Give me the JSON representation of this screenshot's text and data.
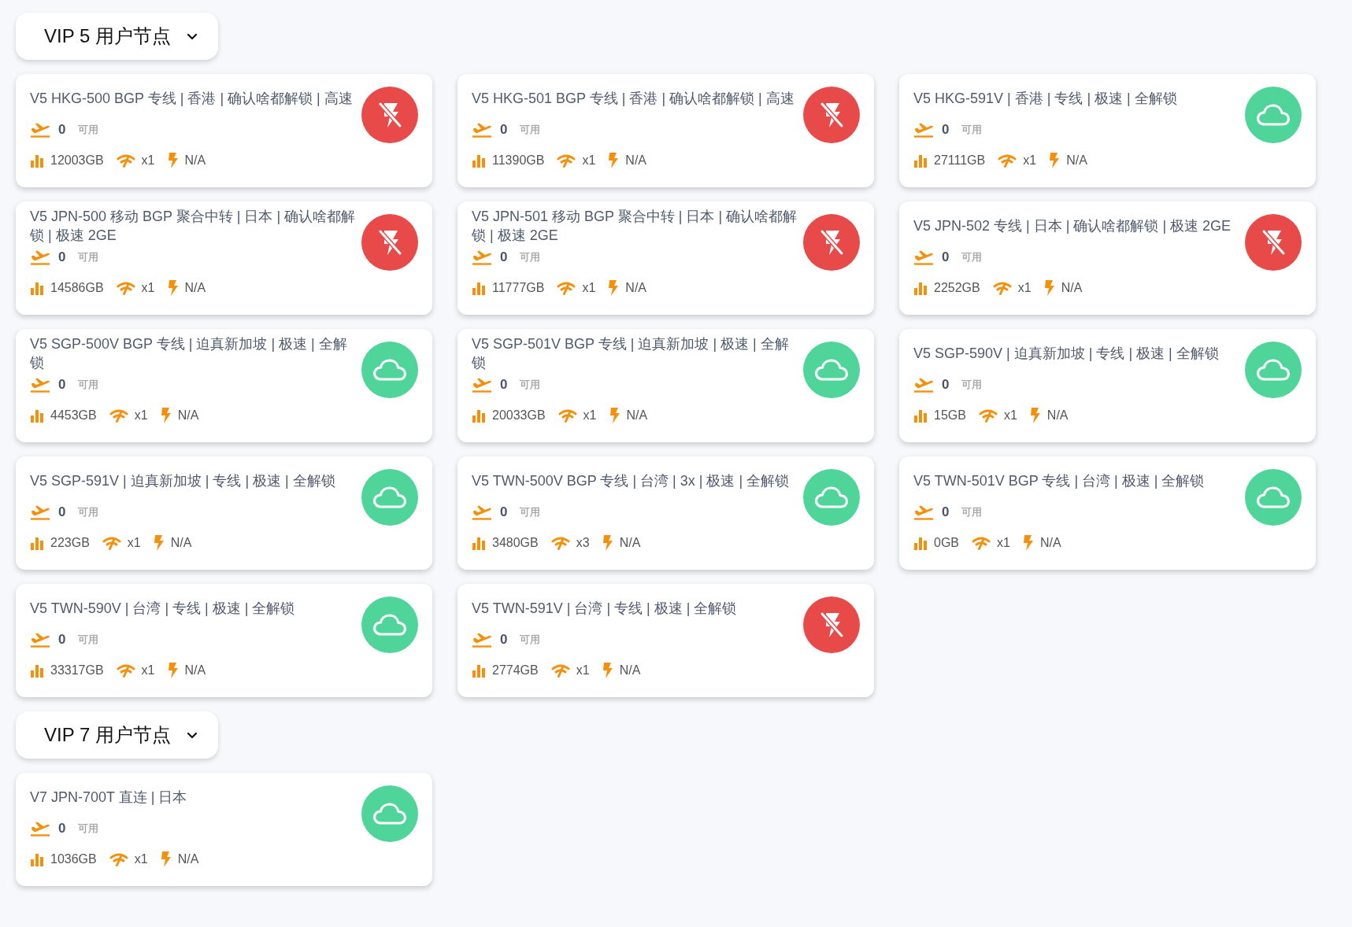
{
  "sections": [
    {
      "title": "VIP 5 用户节点",
      "nodes": [
        {
          "name": "V5 HKG-500 BGP 专线 | 香港 | 确认啥都解锁 | 高速",
          "online": false,
          "available": "0",
          "available_label": "可用",
          "traffic": "12003GB",
          "multiplier": "x1",
          "rate": "N/A"
        },
        {
          "name": "V5 HKG-501 BGP 专线 | 香港 | 确认啥都解锁 | 高速",
          "online": false,
          "available": "0",
          "available_label": "可用",
          "traffic": "11390GB",
          "multiplier": "x1",
          "rate": "N/A"
        },
        {
          "name": "V5 HKG-591V | 香港 | 专线 | 极速 | 全解锁",
          "online": true,
          "available": "0",
          "available_label": "可用",
          "traffic": "27111GB",
          "multiplier": "x1",
          "rate": "N/A"
        },
        {
          "name": "V5 JPN-500 移动 BGP 聚合中转 | 日本 | 确认啥都解锁 | 极速 2GE",
          "online": false,
          "available": "0",
          "available_label": "可用",
          "traffic": "14586GB",
          "multiplier": "x1",
          "rate": "N/A"
        },
        {
          "name": "V5 JPN-501 移动 BGP 聚合中转 | 日本 | 确认啥都解锁 | 极速 2GE",
          "online": false,
          "available": "0",
          "available_label": "可用",
          "traffic": "11777GB",
          "multiplier": "x1",
          "rate": "N/A"
        },
        {
          "name": "V5 JPN-502 专线 | 日本 | 确认啥都解锁 | 极速 2GE",
          "online": false,
          "available": "0",
          "available_label": "可用",
          "traffic": "2252GB",
          "multiplier": "x1",
          "rate": "N/A"
        },
        {
          "name": "V5 SGP-500V BGP 专线 | 迫真新加坡 | 极速 | 全解锁",
          "online": true,
          "available": "0",
          "available_label": "可用",
          "traffic": "4453GB",
          "multiplier": "x1",
          "rate": "N/A"
        },
        {
          "name": "V5 SGP-501V BGP 专线 | 迫真新加坡 | 极速 | 全解锁",
          "online": true,
          "available": "0",
          "available_label": "可用",
          "traffic": "20033GB",
          "multiplier": "x1",
          "rate": "N/A"
        },
        {
          "name": "V5 SGP-590V | 迫真新加坡 | 专线 | 极速 | 全解锁",
          "online": true,
          "available": "0",
          "available_label": "可用",
          "traffic": "15GB",
          "multiplier": "x1",
          "rate": "N/A"
        },
        {
          "name": "V5 SGP-591V | 迫真新加坡 | 专线 | 极速 | 全解锁",
          "online": true,
          "available": "0",
          "available_label": "可用",
          "traffic": "223GB",
          "multiplier": "x1",
          "rate": "N/A"
        },
        {
          "name": "V5 TWN-500V BGP 专线 | 台湾 | 3x | 极速 | 全解锁",
          "online": true,
          "available": "0",
          "available_label": "可用",
          "traffic": "3480GB",
          "multiplier": "x3",
          "rate": "N/A"
        },
        {
          "name": "V5 TWN-501V BGP 专线 | 台湾 | 极速 | 全解锁",
          "online": true,
          "available": "0",
          "available_label": "可用",
          "traffic": "0GB",
          "multiplier": "x1",
          "rate": "N/A"
        },
        {
          "name": "V5 TWN-590V | 台湾 | 专线 | 极速 | 全解锁",
          "online": true,
          "available": "0",
          "available_label": "可用",
          "traffic": "33317GB",
          "multiplier": "x1",
          "rate": "N/A"
        },
        {
          "name": "V5 TWN-591V | 台湾 | 专线 | 极速 | 全解锁",
          "online": false,
          "available": "0",
          "available_label": "可用",
          "traffic": "2774GB",
          "multiplier": "x1",
          "rate": "N/A"
        }
      ]
    },
    {
      "title": "VIP 7 用户节点",
      "nodes": [
        {
          "name": "V7 JPN-700T 直连 | 日本",
          "online": true,
          "available": "0",
          "available_label": "可用",
          "traffic": "1036GB",
          "multiplier": "x1",
          "rate": "N/A"
        }
      ]
    }
  ]
}
